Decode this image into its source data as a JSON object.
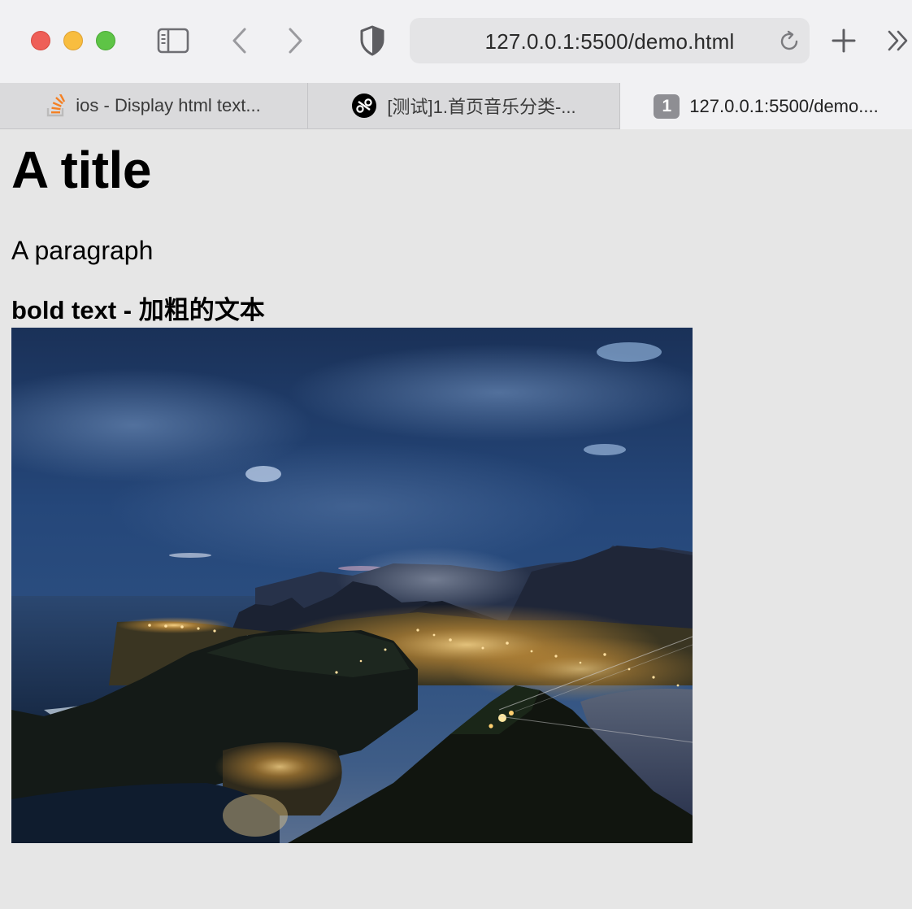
{
  "browser": {
    "address_bar": {
      "url": "127.0.0.1:5500/demo.html"
    },
    "tabs": [
      {
        "label": "ios - Display html text...",
        "favicon": "stackoverflow-icon",
        "active": false
      },
      {
        "label": "[测试]1.首页音乐分类-...",
        "favicon": "music-app-icon",
        "active": false
      },
      {
        "label": "127.0.0.1:5500/demo....",
        "favicon_badge": "1",
        "active": true
      }
    ]
  },
  "page": {
    "title": "A title",
    "paragraph": "A paragraph",
    "bold_text": "bold text - 加粗的文本",
    "image": {
      "alt": "Rio de Janeiro city at night seen from mountain"
    }
  },
  "colors": {
    "traffic_red": "#ee5f58",
    "traffic_yellow": "#f8bd3f",
    "traffic_green": "#5ec446",
    "page_background": "#e6e6e6"
  }
}
